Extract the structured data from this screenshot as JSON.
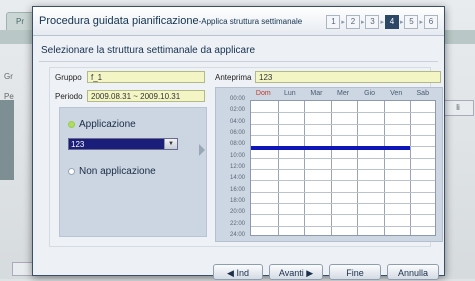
{
  "background": {
    "tab_label": "Pr",
    "label_gruppo": "Gr",
    "label_periodo": "Pe",
    "side_button": "li"
  },
  "dialog": {
    "title": "Procedura guidata pianificazione",
    "subtitle": "-Applica struttura settimanale",
    "steps": [
      "1",
      "2",
      "3",
      "4",
      "5",
      "6"
    ],
    "active_step": "4",
    "heading": "Selezionare la struttura settimanale da applicare"
  },
  "fields": {
    "gruppo_label": "Gruppo",
    "gruppo_value": "f_1",
    "periodo_label": "Periodo",
    "periodo_value": "2009.08.31 ~ 2009.10.31",
    "anteprima_label": "Anteprima",
    "anteprima_value": "123"
  },
  "options": {
    "applicazione_label": "Applicazione",
    "applicazione_selected": "123",
    "non_applicazione_label": "Non applicazione"
  },
  "preview": {
    "days": [
      "Dom",
      "Lun",
      "Mar",
      "Mer",
      "Gio",
      "Ven",
      "Sab"
    ],
    "hours": [
      "00:00",
      "02:00",
      "04:00",
      "06:00",
      "08:00",
      "10:00",
      "12:00",
      "14:00",
      "16:00",
      "18:00",
      "20:00",
      "22:00",
      "24:00"
    ],
    "schedule_bar": {
      "start_hour": 8.0,
      "end_hour": 8.6,
      "day_span": "Dom-Ven"
    },
    "bar_color": "#0e16b8"
  },
  "buttons": {
    "back": "◀ Ind",
    "next": "Avanti ▶",
    "finish": "Fine",
    "cancel": "Annulla"
  }
}
